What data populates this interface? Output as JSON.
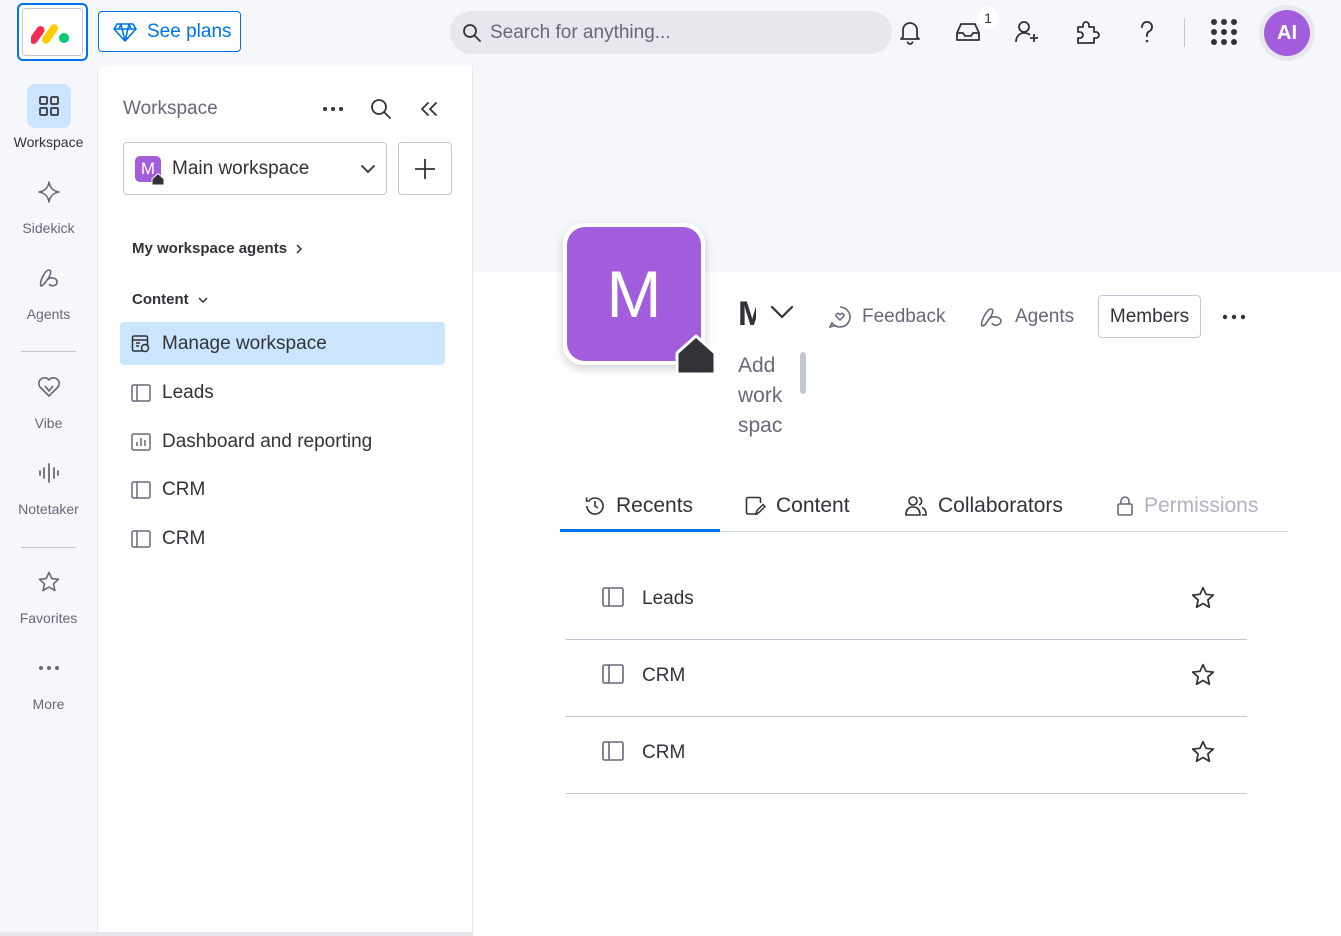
{
  "topbar": {
    "see_plans_label": "See plans",
    "search_placeholder": "Search for anything...",
    "inbox_count": "1",
    "user_initials": "AI"
  },
  "leftnav": {
    "items": [
      {
        "label": "Workspace",
        "icon": "grid-icon",
        "active": true
      },
      {
        "label": "Sidekick",
        "icon": "sparkle-icon"
      },
      {
        "label": "Agents",
        "icon": "agents-icon"
      },
      {
        "label": "Vibe",
        "icon": "heart-icon"
      },
      {
        "label": "Notetaker",
        "icon": "waveform-icon"
      },
      {
        "label": "Favorites",
        "icon": "star-icon"
      },
      {
        "label": "More",
        "icon": "ellipsis-icon"
      }
    ]
  },
  "sidepanel": {
    "title": "Workspace",
    "workspace_letter": "M",
    "workspace_name": "Main workspace",
    "agents_section": "My workspace agents",
    "content_section": "Content",
    "items": [
      {
        "label": "Manage workspace",
        "icon": "manage-workspace-icon",
        "selected": true
      },
      {
        "label": "Leads",
        "icon": "board-icon"
      },
      {
        "label": "Dashboard and reporting",
        "icon": "dashboard-icon"
      },
      {
        "label": "CRM",
        "icon": "board-icon"
      },
      {
        "label": "CRM",
        "icon": "board-icon"
      }
    ]
  },
  "main": {
    "avatar_letter": "M",
    "title_partial": "M",
    "description_lines": [
      "Add",
      "work",
      "spac"
    ],
    "feedback_label": "Feedback",
    "agents_label": "Agents",
    "members_label": "Members",
    "tabs": [
      {
        "label": "Recents",
        "icon": "history-icon",
        "active": true
      },
      {
        "label": "Content",
        "icon": "content-icon"
      },
      {
        "label": "Collaborators",
        "icon": "people-icon"
      },
      {
        "label": "Permissions",
        "icon": "lock-icon",
        "disabled": true
      }
    ],
    "recents": [
      {
        "label": "Leads"
      },
      {
        "label": "CRM"
      },
      {
        "label": "CRM"
      }
    ]
  },
  "colors": {
    "accent": "#0073ea",
    "workspace_purple": "#a25ddc",
    "selected_bg": "#cce5ff"
  }
}
